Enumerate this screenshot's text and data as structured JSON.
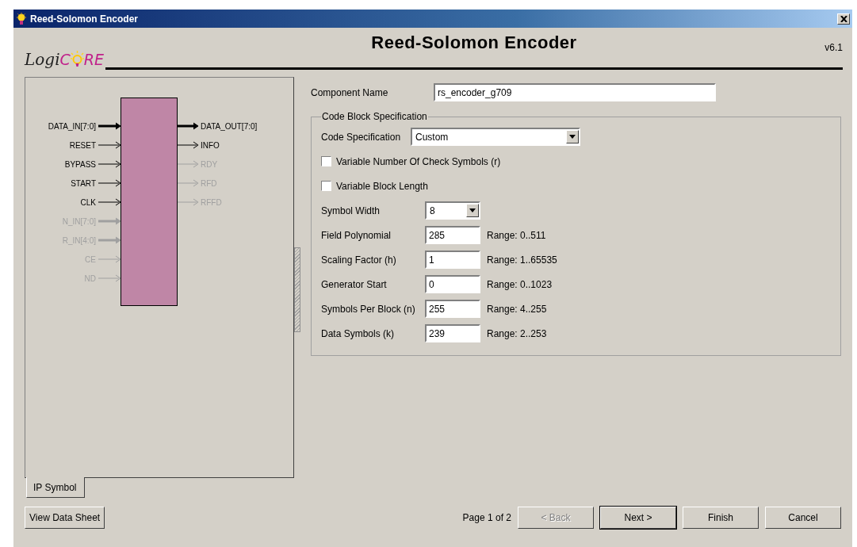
{
  "window": {
    "title": "Reed-Solomon Encoder"
  },
  "header": {
    "logo": [
      "Logi",
      "C",
      "RE"
    ],
    "title": "Reed-Solomon Encoder",
    "version": "v6.1"
  },
  "symbol": {
    "inputs": [
      {
        "name": "DATA_IN[7:0]",
        "kind": "bus",
        "enabled": true
      },
      {
        "name": "RESET",
        "kind": "wire",
        "enabled": true
      },
      {
        "name": "BYPASS",
        "kind": "wire",
        "enabled": true
      },
      {
        "name": "START",
        "kind": "wire",
        "enabled": true
      },
      {
        "name": "CLK",
        "kind": "wire",
        "enabled": true
      },
      {
        "name": "N_IN[7:0]",
        "kind": "bus",
        "enabled": false
      },
      {
        "name": "R_IN[4:0]",
        "kind": "bus",
        "enabled": false
      },
      {
        "name": "CE",
        "kind": "wire",
        "enabled": false
      },
      {
        "name": "ND",
        "kind": "wire",
        "enabled": false
      }
    ],
    "outputs": [
      {
        "name": "DATA_OUT[7:0]",
        "kind": "bus",
        "enabled": true
      },
      {
        "name": "INFO",
        "kind": "wire",
        "enabled": true
      },
      {
        "name": "RDY",
        "kind": "wire",
        "enabled": false
      },
      {
        "name": "RFD",
        "kind": "wire",
        "enabled": false
      },
      {
        "name": "RFFD",
        "kind": "wire",
        "enabled": false
      }
    ]
  },
  "tabs": [
    {
      "label": "IP Symbol",
      "selected": true
    }
  ],
  "component_name": {
    "label": "Component Name",
    "value": "rs_encoder_g709"
  },
  "group": {
    "title": "Code Block Specification",
    "fields": [
      {
        "kind": "dropdown",
        "label": "Code Specification",
        "value": "Custom",
        "wide": true
      },
      {
        "kind": "checkbox",
        "label": "Variable Number Of Check Symbols (r)",
        "checked": false
      },
      {
        "kind": "checkbox",
        "label": "Variable Block Length",
        "checked": false
      },
      {
        "kind": "dropdown",
        "label": "Symbol Width",
        "value": "8",
        "wide": false
      },
      {
        "kind": "text",
        "label": "Field Polynomial",
        "value": "285",
        "range": "Range: 0..511"
      },
      {
        "kind": "text",
        "label": "Scaling Factor (h)",
        "value": "1",
        "range": "Range: 1..65535"
      },
      {
        "kind": "text",
        "label": "Generator Start",
        "value": "0",
        "range": "Range: 0..1023"
      },
      {
        "kind": "text",
        "label": "Symbols Per Block (n)",
        "value": "255",
        "range": "Range: 4..255"
      },
      {
        "kind": "text",
        "label": "Data Symbols (k)",
        "value": "239",
        "range": "Range: 2..253"
      }
    ]
  },
  "footer": {
    "datasheet_button": "View Data Sheet",
    "page": "Page 1 of 2",
    "buttons": [
      {
        "label": "< Back",
        "disabled": true
      },
      {
        "label": "Next >",
        "disabled": false,
        "default": true
      },
      {
        "label": "Finish",
        "disabled": false,
        "default": false
      },
      {
        "label": "Cancel",
        "disabled": false,
        "default": false
      }
    ]
  }
}
